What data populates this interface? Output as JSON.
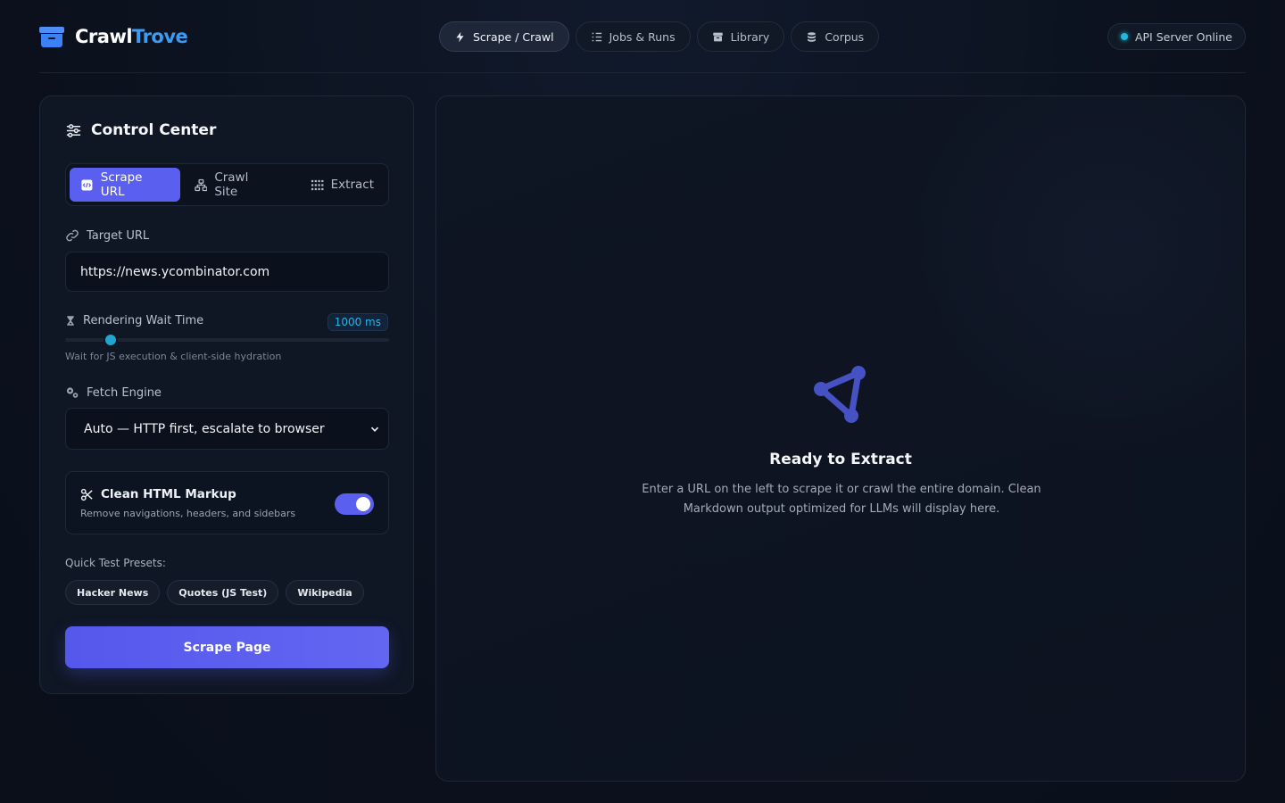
{
  "brand": {
    "name_part1": "Crawl",
    "name_part2": "Trove"
  },
  "nav": {
    "items": [
      {
        "label": "Scrape / Crawl",
        "icon": "bolt-icon",
        "active": true
      },
      {
        "label": "Jobs & Runs",
        "icon": "list-icon",
        "active": false
      },
      {
        "label": "Library",
        "icon": "archive-icon",
        "active": false
      },
      {
        "label": "Corpus",
        "icon": "database-icon",
        "active": false
      }
    ]
  },
  "status": {
    "label": "API Server Online",
    "color": "#22b8d8"
  },
  "control": {
    "title": "Control Center",
    "tabs": [
      {
        "label": "Scrape URL",
        "icon": "file-code-icon",
        "active": true
      },
      {
        "label": "Crawl Site",
        "icon": "sitemap-icon",
        "active": false
      },
      {
        "label": "Extract",
        "icon": "grid-icon",
        "active": false
      }
    ],
    "target_url": {
      "label": "Target URL",
      "value": "https://news.ycombinator.com"
    },
    "wait_time": {
      "label": "Rendering Wait Time",
      "value_label": "1000 ms",
      "hint": "Wait for JS execution & client-side hydration",
      "value_fraction": 0.14
    },
    "fetch_engine": {
      "label": "Fetch Engine",
      "selected": "Auto — HTTP first, escalate to browser"
    },
    "clean_html": {
      "title": "Clean HTML Markup",
      "subtitle": "Remove navigations, headers, and sidebars",
      "enabled": true
    },
    "presets": {
      "label": "Quick Test Presets:",
      "items": [
        "Hacker News",
        "Quotes (JS Test)",
        "Wikipedia"
      ]
    },
    "submit_label": "Scrape Page"
  },
  "output": {
    "title": "Ready to Extract",
    "description": "Enter a URL on the left to scrape it or crawl the entire domain. Clean Markdown output optimized for LLMs will display here."
  },
  "colors": {
    "accent": "#5b5ff0",
    "cyan": "#22b8d8",
    "brand_blue": "#3b9cf6"
  }
}
